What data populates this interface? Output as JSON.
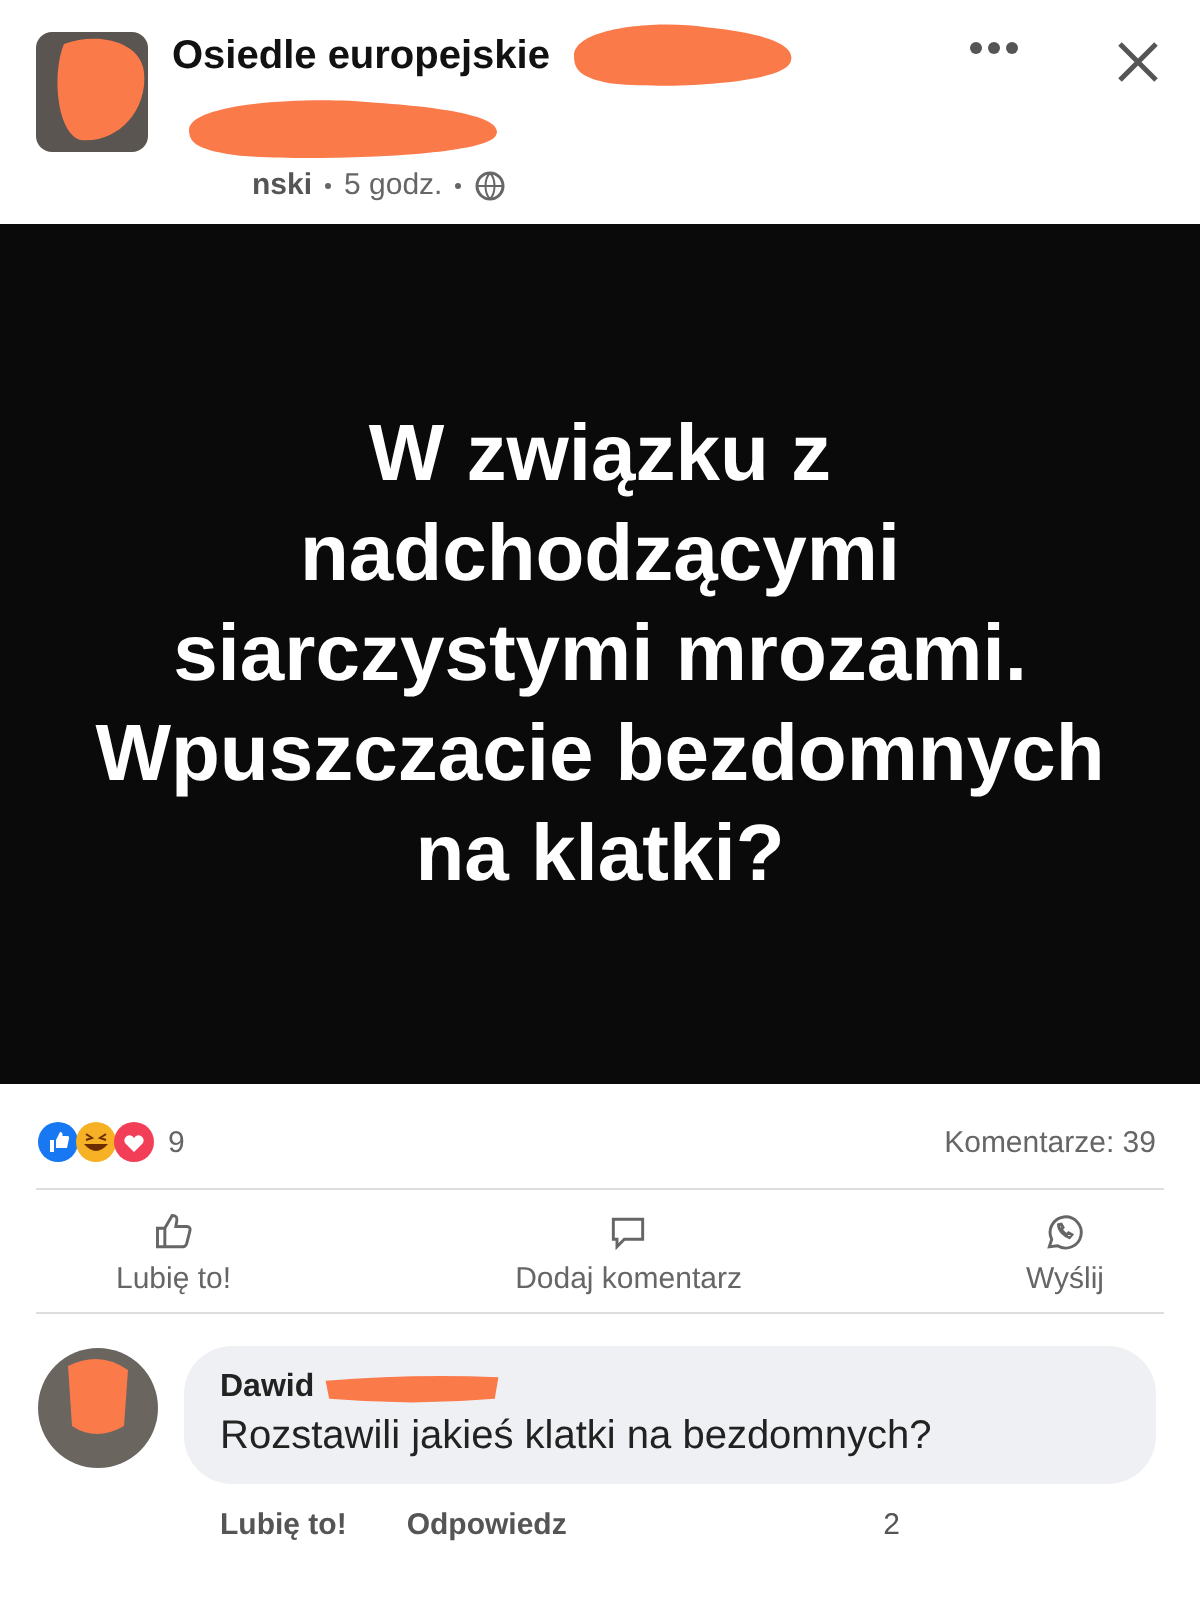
{
  "post": {
    "group_name": "Osiedle europejskie",
    "author": "nski",
    "time": "5 godz.",
    "text": "W związku z nadchodzącymi siarczystymi mrozami. Wpuszczacie bezdomnych na klatki?"
  },
  "reactions": {
    "count": "9",
    "comments": "Komentarze: 39"
  },
  "actions": [
    {
      "kind": "like",
      "label": "Lubię to!"
    },
    {
      "kind": "comment",
      "label": "Dodaj komentarz"
    },
    {
      "kind": "share",
      "label": "Wyślij"
    }
  ],
  "comment": {
    "author": "Dawid",
    "text": "Rozstawili jakieś klatki na bezdomnych?",
    "actions": [
      "Lubię to!",
      "Odpowiedz"
    ],
    "reaction_count": "2"
  }
}
